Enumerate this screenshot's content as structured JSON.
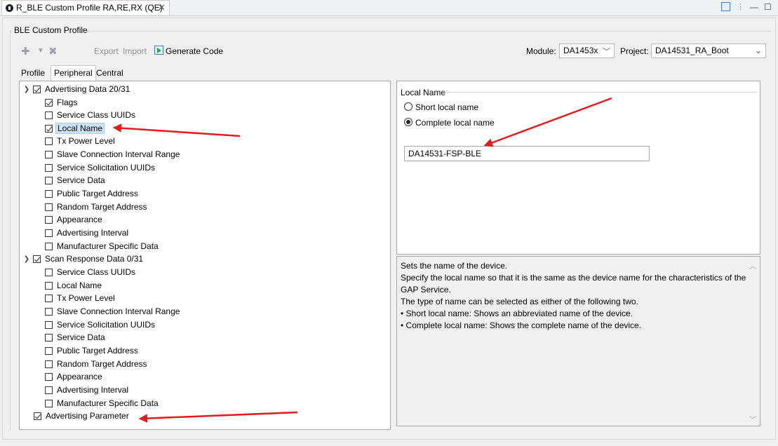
{
  "editor_tab": {
    "title": "R_BLE Custom Profile RA,RE,RX (QE)",
    "close": "✕"
  },
  "window": {
    "minimize": "—",
    "maximize": "☐"
  },
  "group": {
    "title": "BLE Custom Profile"
  },
  "toolbar": {
    "export_label": "Export",
    "import_label": "Import",
    "generate_label": "Generate Code",
    "module_label": "Module:",
    "module_value": "DA1453x",
    "project_label": "Project:",
    "project_value": "DA14531_RA_Boot"
  },
  "tabs": [
    {
      "label": "Profile"
    },
    {
      "label": "Peripheral"
    },
    {
      "label": "Central"
    }
  ],
  "tree": {
    "adv_root": "Advertising Data 20/31",
    "adv_items": [
      "Flags",
      "Service Class UUIDs",
      "Local Name",
      "Tx Power Level",
      "Slave Connection Interval Range",
      "Service Solicitation UUIDs",
      "Service Data",
      "Public Target Address",
      "Random Target Address",
      "Appearance",
      "Advertising Interval",
      "Manufacturer Specific Data"
    ],
    "scan_root": "Scan Response Data 0/31",
    "scan_items": [
      "Service Class UUIDs",
      "Local Name",
      "Tx Power Level",
      "Slave Connection Interval Range",
      "Service Solicitation UUIDs",
      "Service Data",
      "Public Target Address",
      "Random Target Address",
      "Appearance",
      "Advertising Interval",
      "Manufacturer Specific Data"
    ],
    "adv_param": "Advertising Parameter"
  },
  "local_name": {
    "group_title": "Local Name",
    "short_label": "Short local name",
    "complete_label": "Complete local name",
    "selected": "Complete local name",
    "value": "DA14531-FSP-BLE"
  },
  "description": {
    "lines": [
      "Sets the name of the device.",
      "Specify the local name so that it is the same as the device name for the characteristics of the GAP Service.",
      "The type of name can be selected as either of the following two.",
      "• Short local name: Shows an abbreviated name of the device.",
      "• Complete local name: Shows the complete name of the device."
    ]
  },
  "colors": {
    "annotation_arrow": "#e31b1b",
    "selection": "#cce3f6"
  }
}
